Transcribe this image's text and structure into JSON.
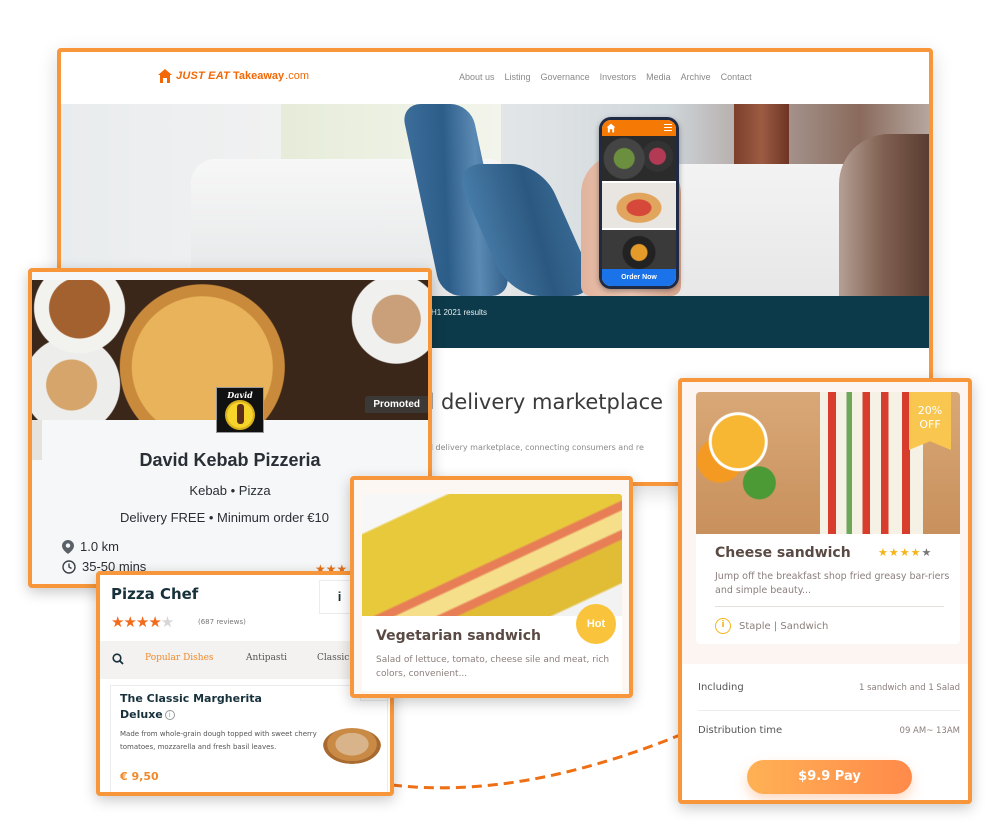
{
  "colors": {
    "accent": "#f7963a",
    "brand": "#f36805",
    "news_bar": "#0d3a4a",
    "order_now": "#1a73e8",
    "hot_badge": "#f9c33b",
    "pay_gradient_start": "#ffb155",
    "pay_gradient_end": "#ff8a4a"
  },
  "site": {
    "logo": {
      "icon": "house-icon",
      "just_eat": "JUST EAT",
      "takeaway": "Takeaway",
      "dotcom": ".com"
    },
    "nav": [
      "About us",
      "Listing",
      "Governance",
      "Investors",
      "Media",
      "Archive",
      "Contact"
    ],
    "phone": {
      "icon": "house-icon",
      "menu_icon": "hamburger-icon",
      "order_now": "Order Now"
    },
    "news": "H1 2021 results",
    "title": "d delivery marketplace",
    "subtitle": "od delivery marketplace, connecting consumers and re"
  },
  "kebab": {
    "logo_text": "David",
    "promoted": "Promoted",
    "name": "David Kebab Pizzeria",
    "cuisine": "Kebab • Pizza",
    "delivery": "Delivery FREE • Minimum order €10",
    "distance": "1.0 km",
    "time": "35-50 mins",
    "stars": "★★★"
  },
  "chef": {
    "title": "Pizza Chef",
    "info_button": "i",
    "rating": 4,
    "stars_on": "★★★★",
    "stars_off": "★",
    "reviews": "(687 reviews)",
    "tabs": [
      "Popular Dishes",
      "Antipasti",
      "Classic P"
    ],
    "active_tab": "Popular Dishes",
    "dish": {
      "name": "The Classic Margherita Deluxe",
      "info": "i",
      "description": "Made from whole-grain dough topped with sweet cherry tomatoes, mozzarella and fresh basil leaves.",
      "price": "€ 9,50",
      "add": "+"
    }
  },
  "veg": {
    "badge": "Hot",
    "title": "Vegetarian sandwich",
    "description": "Salad of lettuce, tomato, cheese sile and meat, rich colors, convenient..."
  },
  "cheese": {
    "badge_line1": "20%",
    "badge_line2": "OFF",
    "title": "Cheese sandwich",
    "rating": 4,
    "stars_on": "★★★★",
    "stars_off": "★",
    "description": "Jump off the breakfast shop fried greasy bar-riers and simple beauty...",
    "tags": "Staple  |  Sandwich",
    "including_label": "Including",
    "including_value": "1 sandwich and 1 Salad",
    "distribution_label": "Distribution time",
    "distribution_value": "09 AM~ 13AM",
    "pay_button": "$9.9 Pay"
  }
}
